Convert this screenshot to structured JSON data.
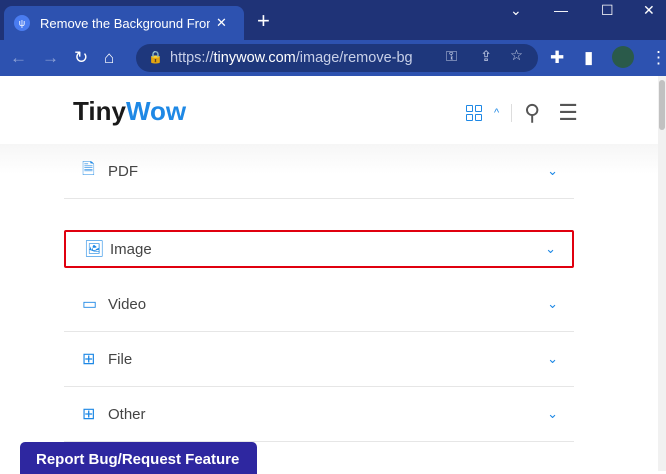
{
  "browser": {
    "tab_title": "Remove the Background From an Image",
    "url_host": "tinywow.com",
    "url_scheme": "https://",
    "url_path": "/image/remove-bg"
  },
  "site": {
    "logo_a": "Tiny",
    "logo_b": "Wow"
  },
  "menu": [
    {
      "label": "PDF",
      "icon": "file-icon"
    },
    {
      "label": "Image",
      "icon": "image-icon",
      "selected": true
    },
    {
      "label": "Video",
      "icon": "video-icon"
    },
    {
      "label": "File",
      "icon": "grid-icon"
    },
    {
      "label": "Other",
      "icon": "grid-icon"
    }
  ],
  "report_button": "Report Bug/Request Feature"
}
